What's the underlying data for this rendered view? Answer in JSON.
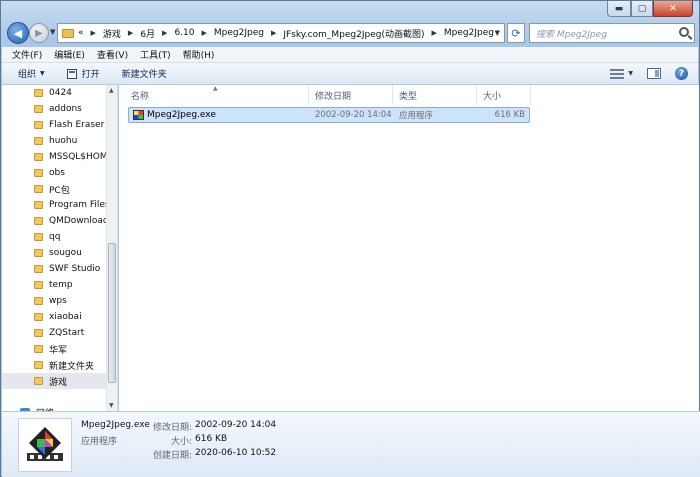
{
  "window": {
    "caption_buttons": [
      "▬",
      "▢",
      "✕"
    ]
  },
  "address": {
    "overflow": "«",
    "crumbs": [
      "游戏",
      "6月",
      "6.10",
      "Mpeg2Jpeg",
      "JFsky.com_Mpeg2Jpeg(动画截图)",
      "Mpeg2Jpeg"
    ],
    "search_placeholder": "搜索 Mpeg2Jpeg"
  },
  "menu": [
    "文件(F)",
    "编辑(E)",
    "查看(V)",
    "工具(T)",
    "帮助(H)"
  ],
  "toolbar": {
    "organize": "组织",
    "open": "打开",
    "new_folder": "新建文件夹"
  },
  "nav": {
    "items": [
      "0424",
      "addons",
      "Flash Eraser",
      "huohu",
      "MSSQL$HOM",
      "obs",
      "PC包",
      "Program Files",
      "QMDownload",
      "qq",
      "sougou",
      "SWF Studio",
      "temp",
      "wps",
      "xiaobai",
      "ZQStart",
      "华军",
      "新建文件夹",
      "游戏"
    ],
    "selected": "游戏",
    "network": "网络"
  },
  "columns": {
    "name": "名称",
    "modified": "修改日期",
    "type": "类型",
    "size": "大小"
  },
  "files": [
    {
      "name": "Mpeg2Jpeg.exe",
      "modified": "2002-09-20 14:04",
      "type": "应用程序",
      "size": "616 KB"
    }
  ],
  "details": {
    "name": "Mpeg2Jpeg.exe",
    "type": "应用程序",
    "modified_label": "修改日期:",
    "modified": "2002-09-20 14:04",
    "size_label": "大小:",
    "size": "616 KB",
    "created_label": "创建日期:",
    "created": "2020-06-10 10:52"
  },
  "colors": {
    "frame": "#a9c8e8",
    "selection": "#cce3fb",
    "close": "#c8452a"
  }
}
